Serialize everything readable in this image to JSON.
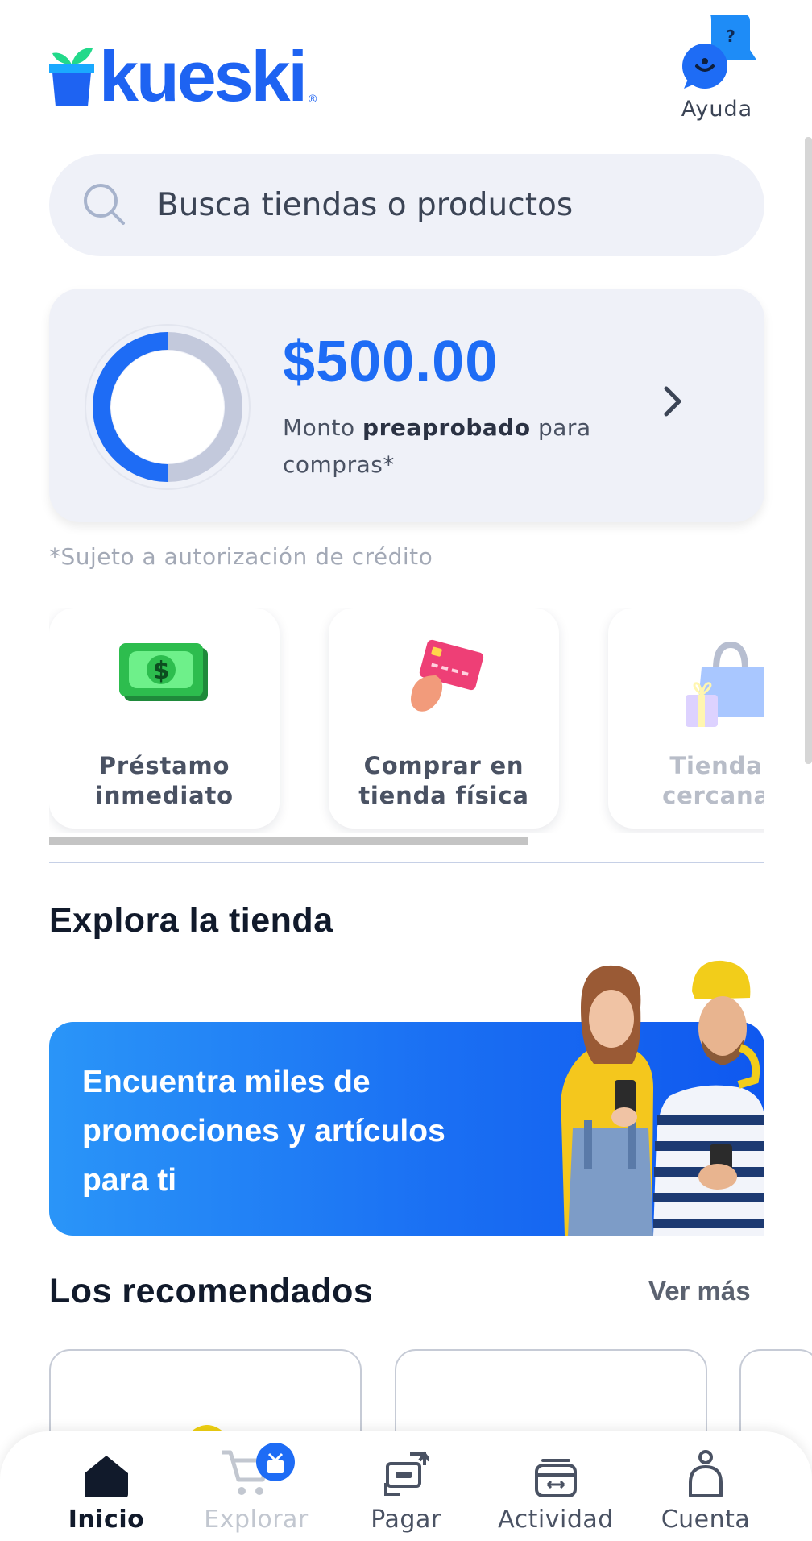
{
  "header": {
    "logo_text": "kueski",
    "logo_reg": "®",
    "help_label": "Ayuda"
  },
  "search": {
    "placeholder": "Busca tiendas o productos"
  },
  "credit": {
    "amount": "$500.00",
    "desc_prefix": "Monto ",
    "desc_bold": "preaprobado",
    "desc_suffix": " para compras*",
    "used_fraction": 0.5,
    "colors": {
      "primary": "#1e6cf5",
      "remaining": "#c3c9dc"
    }
  },
  "disclaimer": "*Sujeto a autorización de crédito",
  "actions": [
    {
      "label_line1": "Préstamo",
      "label_line2": "inmediato",
      "icon": "cash-icon"
    },
    {
      "label_line1": "Comprar en",
      "label_line2": "tienda física",
      "icon": "card-hand-icon"
    },
    {
      "label_line1": "Tiendas",
      "label_line2": "cercanas",
      "icon": "shopping-bag-icon"
    }
  ],
  "explore": {
    "title": "Explora la tienda",
    "banner_text": "Encuentra miles de promociones y artículos para ti"
  },
  "recommended": {
    "title": "Los recomendados",
    "more_label": "Ver más"
  },
  "bottom_nav": [
    {
      "label": "Inicio",
      "icon": "home-icon",
      "state": "active"
    },
    {
      "label": "Explorar",
      "icon": "cart-icon",
      "state": "disabled"
    },
    {
      "label": "Pagar",
      "icon": "pay-icon",
      "state": "normal"
    },
    {
      "label": "Actividad",
      "icon": "activity-icon",
      "state": "normal"
    },
    {
      "label": "Cuenta",
      "icon": "account-icon",
      "state": "normal"
    }
  ]
}
